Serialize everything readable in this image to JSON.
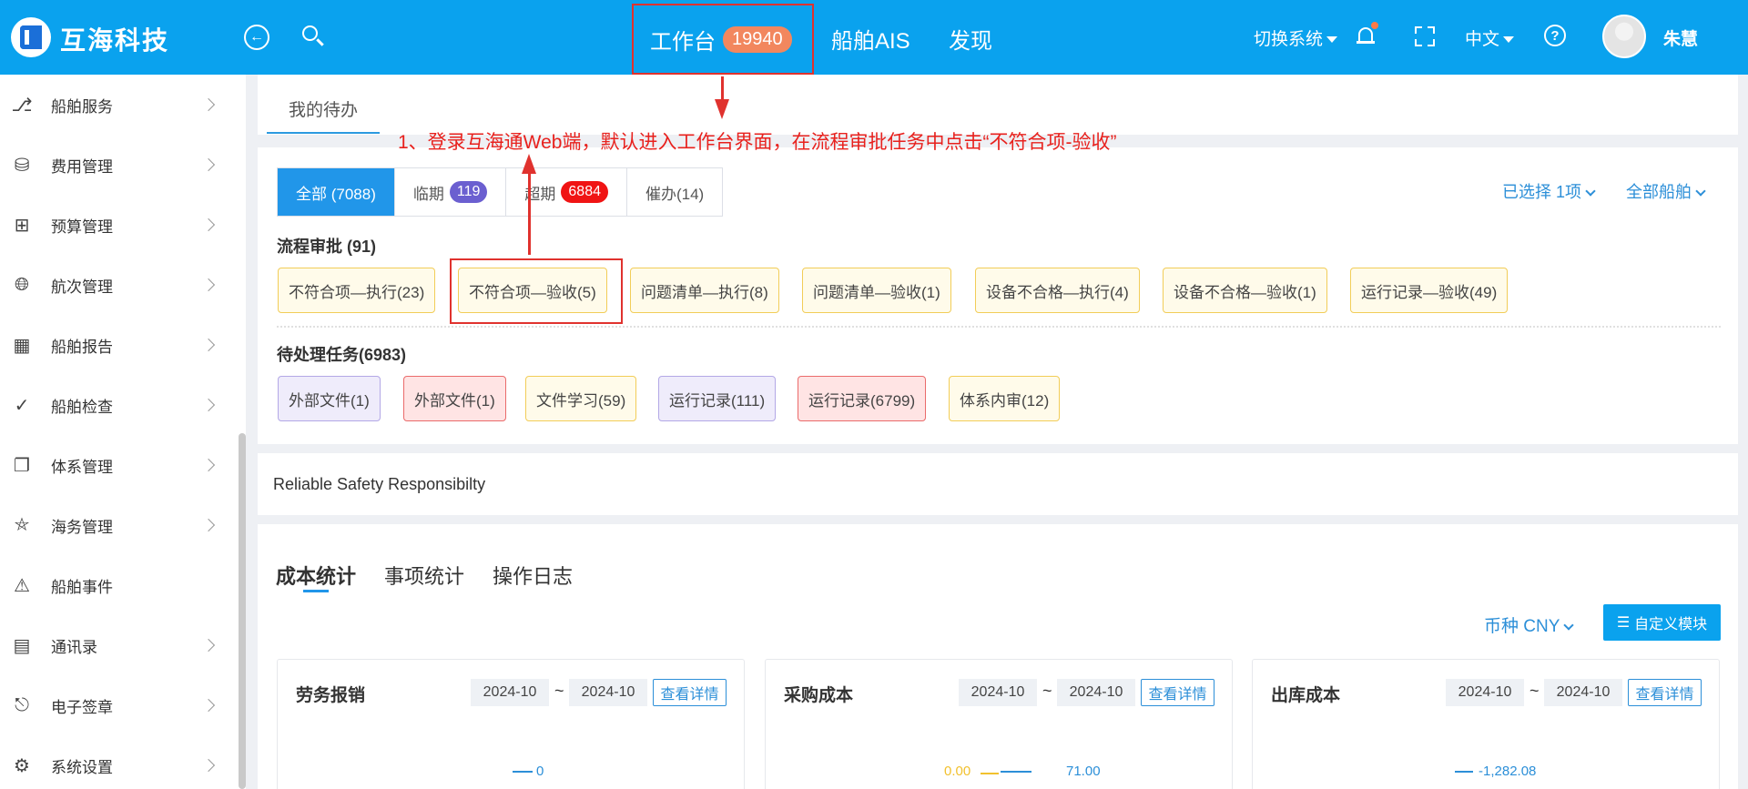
{
  "header": {
    "brand": "互海科技",
    "nav": {
      "workbench": "工作台",
      "workbench_count": "19940",
      "ais": "船舶AIS",
      "discover": "发现"
    },
    "switch_system": "切换系统",
    "language": "中文",
    "user": "朱慧"
  },
  "sidebar": {
    "items": [
      {
        "label": "船舶服务",
        "icon": "brush-icon"
      },
      {
        "label": "费用管理",
        "icon": "database-icon"
      },
      {
        "label": "预算管理",
        "icon": "calculator-icon"
      },
      {
        "label": "航次管理",
        "icon": "globe-icon"
      },
      {
        "label": "船舶报告",
        "icon": "calendar-icon"
      },
      {
        "label": "船舶检查",
        "icon": "check-circle-icon"
      },
      {
        "label": "体系管理",
        "icon": "documents-icon"
      },
      {
        "label": "海务管理",
        "icon": "signpost-icon"
      },
      {
        "label": "船舶事件",
        "icon": "warning-icon"
      },
      {
        "label": "通讯录",
        "icon": "contacts-icon"
      },
      {
        "label": "电子签章",
        "icon": "stamp-icon"
      },
      {
        "label": "系统设置",
        "icon": "gear-icon"
      }
    ]
  },
  "tabs": {
    "mine": "我的待办"
  },
  "annotation": "1、登录互海通Web端，默认进入工作台界面，在流程审批任务中点击“不符合项-验收”",
  "filters": {
    "all": "全部 (7088)",
    "near": "临期",
    "near_count": "119",
    "over": "超期",
    "over_count": "6884",
    "urge": "催办(14)",
    "selected": "已选择 1项",
    "all_ships": "全部船舶"
  },
  "approval": {
    "title": "流程审批 (91)",
    "items": [
      "不符合项—执行(23)",
      "不符合项—验收(5)",
      "问题清单—执行(8)",
      "问题清单—验收(1)",
      "设备不合格—执行(4)",
      "设备不合格—验收(1)",
      "运行记录—验收(49)"
    ]
  },
  "pending": {
    "title": "待处理任务(6983)",
    "items": [
      "外部文件(1)",
      "外部文件(1)",
      "文件学习(59)",
      "运行记录(111)",
      "运行记录(6799)",
      "体系内审(12)"
    ]
  },
  "slogan": "Reliable Safety Responsibilty",
  "stats": {
    "tabs": [
      "成本统计",
      "事项统计",
      "操作日志"
    ],
    "currency": "币种 CNY",
    "custom": "自定义模块",
    "cards": [
      {
        "title": "劳务报销",
        "from": "2024-10",
        "to": "2024-10",
        "detail": "查看详情",
        "values": [
          "0"
        ]
      },
      {
        "title": "采购成本",
        "from": "2024-10",
        "to": "2024-10",
        "detail": "查看详情",
        "values": [
          "0.00",
          "71.00"
        ]
      },
      {
        "title": "出库成本",
        "from": "2024-10",
        "to": "2024-10",
        "detail": "查看详情",
        "values": [
          "-1,282.08"
        ]
      }
    ]
  },
  "colors": {
    "header": "#0aa2ee",
    "accent": "#2196e9",
    "annotation": "#e8211d",
    "near_badge": "#6b5fd0",
    "over_badge": "#f01414"
  }
}
